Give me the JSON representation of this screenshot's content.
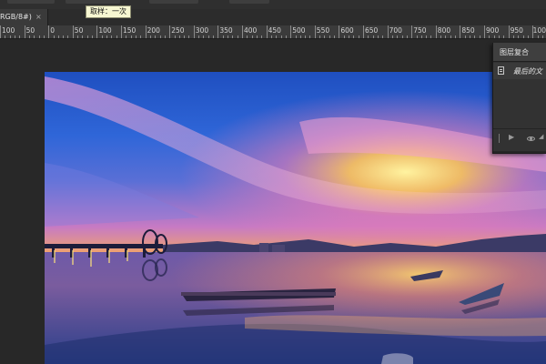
{
  "tooltip": {
    "text": "取样：一次"
  },
  "document_tab": {
    "label": "RGB/8#)",
    "close": "×"
  },
  "ruler": {
    "labels": [
      "100",
      "50",
      "0",
      "50",
      "100",
      "150",
      "200",
      "250",
      "300",
      "350",
      "400",
      "450",
      "500",
      "550",
      "600",
      "650",
      "700",
      "750",
      "800",
      "850",
      "900",
      "950",
      "100"
    ]
  },
  "layer_comps_panel": {
    "title": "图层复合",
    "item": "最后的文",
    "footer": {
      "play": "▶",
      "eye_chevron": "◢"
    }
  },
  "colors": {
    "app_bg": "#262626",
    "ruler_bg": "#3b3b3b",
    "panel_bg": "#323232",
    "tooltip_bg": "#f7f7d2"
  },
  "icons": [
    "document-icon",
    "play-icon",
    "visibility-eye-icon",
    "close-icon"
  ]
}
